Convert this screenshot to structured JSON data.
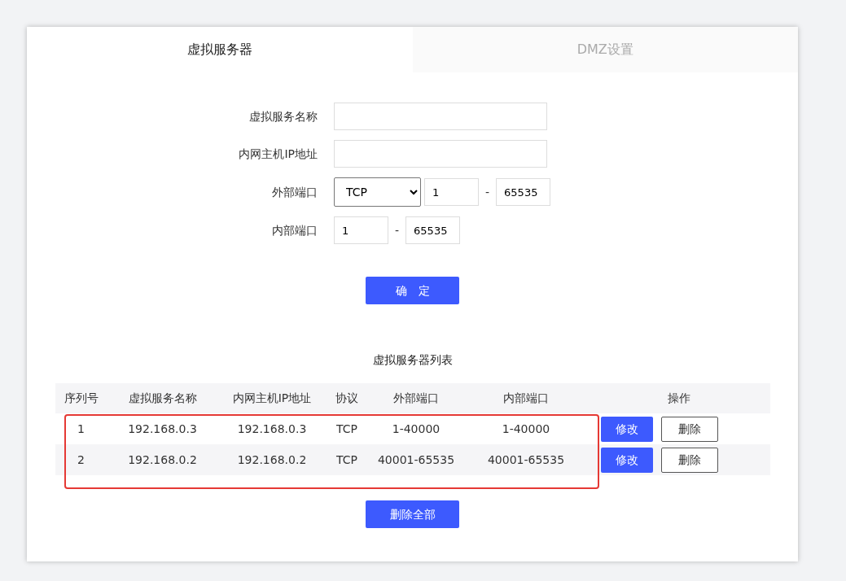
{
  "tabs": [
    {
      "label": "虚拟服务器",
      "selected": true
    },
    {
      "label": "DMZ设置",
      "selected": false
    }
  ],
  "form": {
    "fields": [
      {
        "kind": "text",
        "label": "虚拟服务名称"
      },
      {
        "kind": "text",
        "label": "内网主机IP地址"
      },
      {
        "kind": "ports",
        "label": "外部端口",
        "protocol": "TCP",
        "from": "1",
        "separator": "-",
        "to": "65535"
      },
      {
        "kind": "ports",
        "label": "内部端口",
        "from": "1",
        "separator": "-",
        "to": "65535"
      }
    ],
    "submit": "确　定"
  },
  "table": {
    "title": "虚拟服务器列表",
    "highlighted": true,
    "columns": [
      "序列号",
      "虚拟服务名称",
      "内网主机IP地址",
      "协议",
      "外部端口",
      "内部端口",
      "操作"
    ],
    "rows": [
      {
        "cells": [
          "1",
          "192.168.0.3",
          "192.168.0.3",
          "TCP",
          "1-40000",
          "1-40000"
        ],
        "actions": [
          "修改",
          "删除"
        ]
      },
      {
        "cells": [
          "2",
          "192.168.0.2",
          "192.168.0.2",
          "TCP",
          "40001-65535",
          "40001-65535"
        ],
        "actions": [
          "修改",
          "删除"
        ]
      }
    ]
  },
  "delete_all": "删除全部"
}
